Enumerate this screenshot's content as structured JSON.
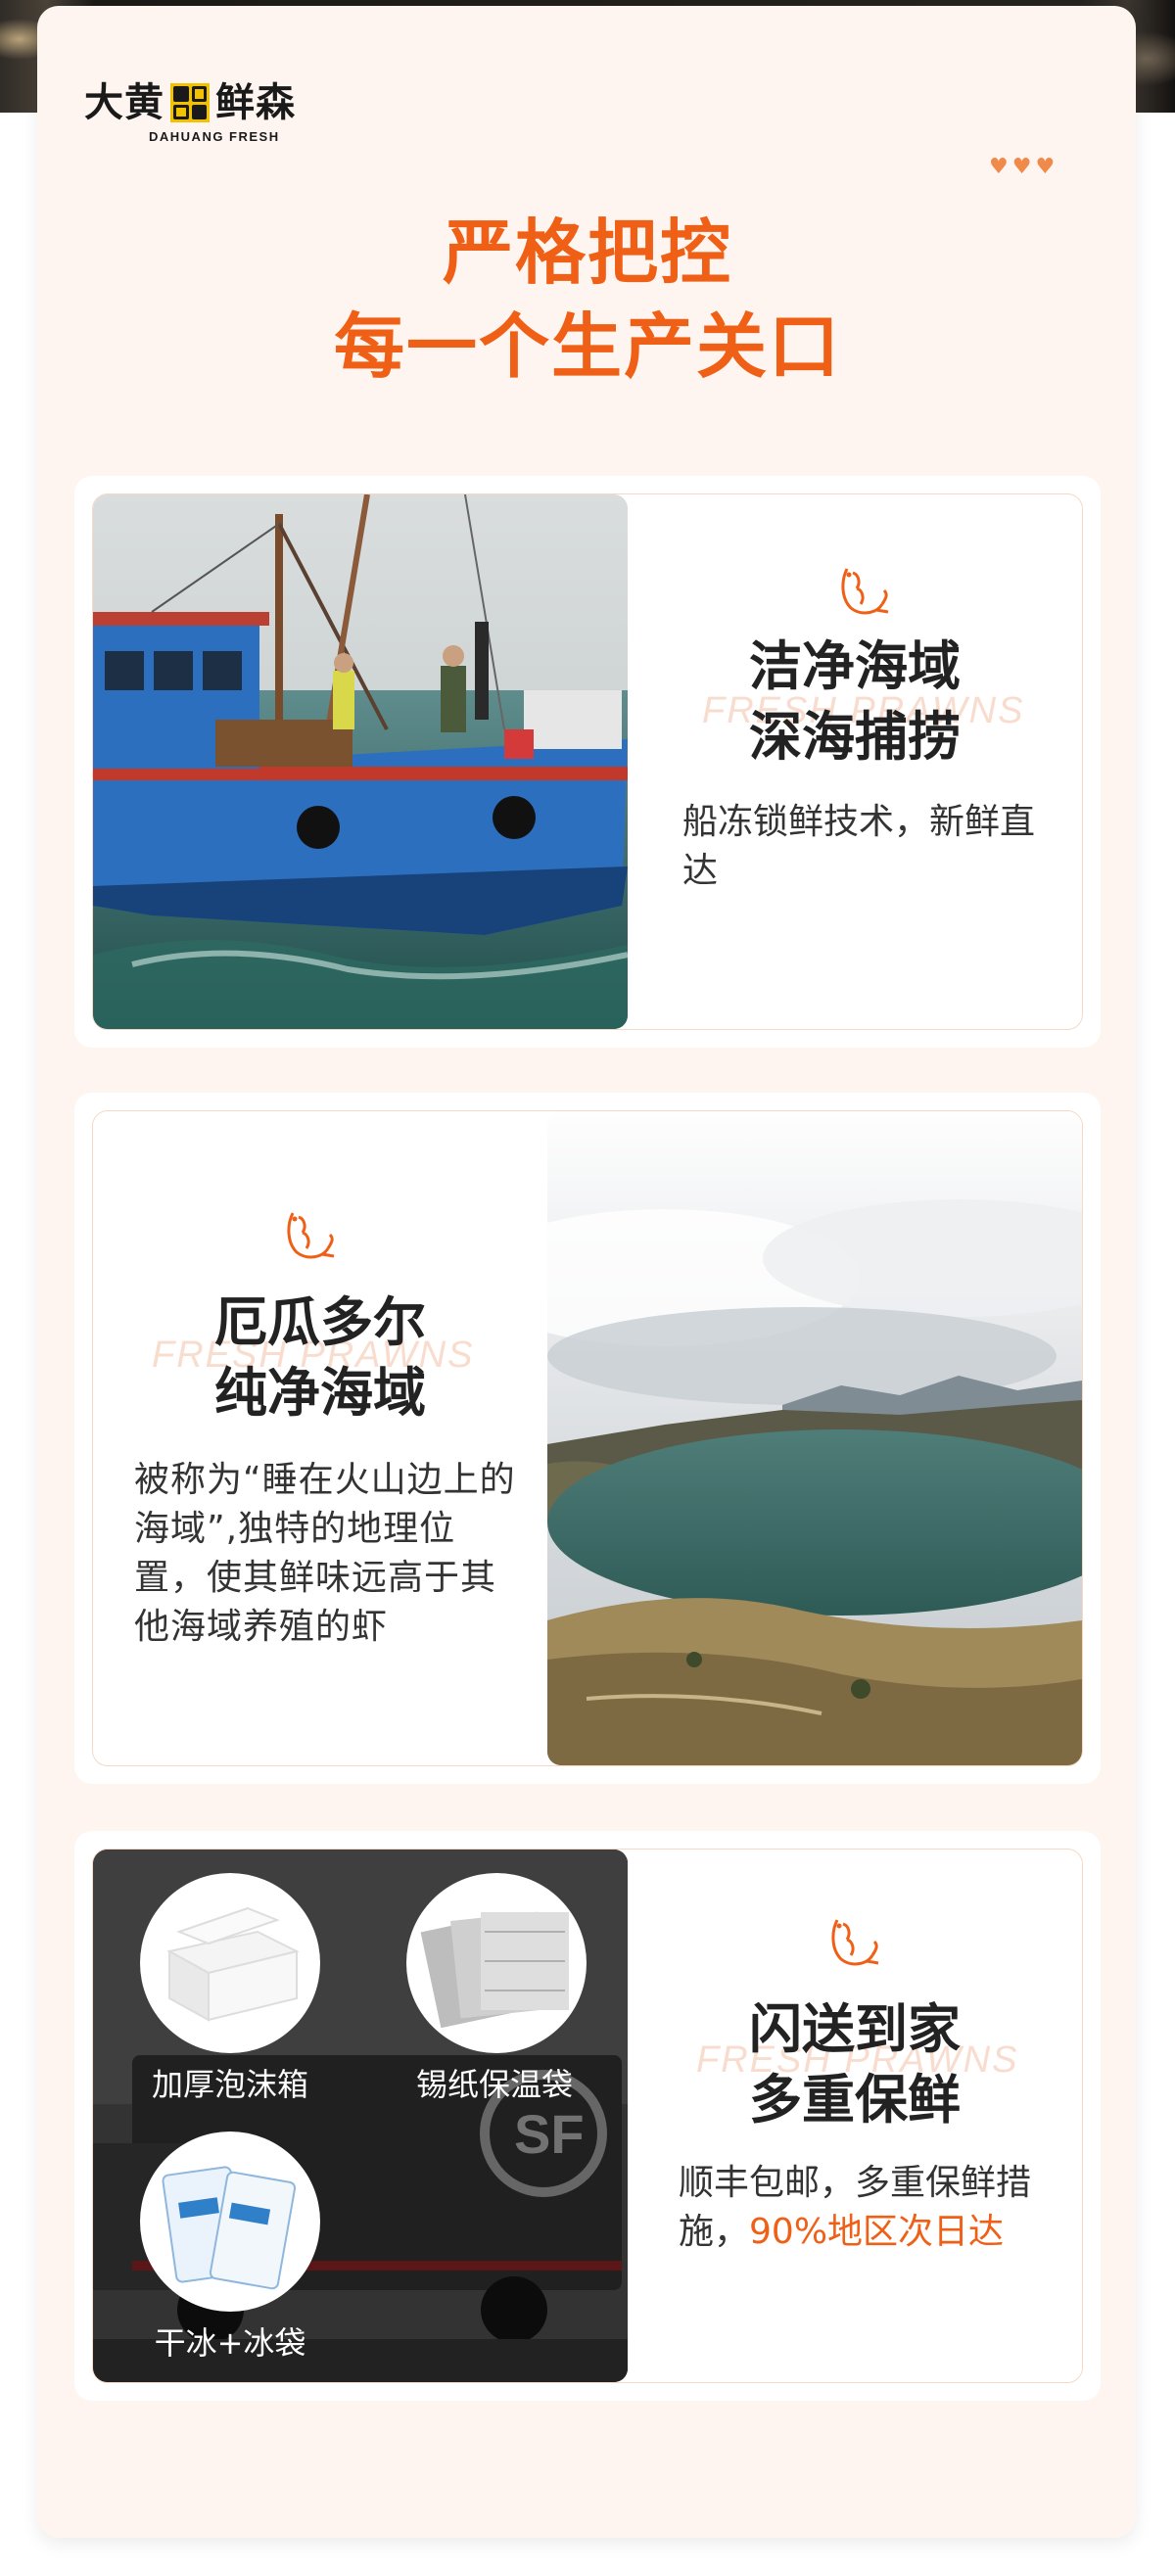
{
  "brand": {
    "name_left": "大黄",
    "name_right": "鲜森",
    "name_en": "DAHUANG FRESH"
  },
  "decor": {
    "hearts": [
      "♥",
      "♥",
      "♥"
    ]
  },
  "headline": {
    "line1": "严格把控",
    "line2": "每一个生产关口"
  },
  "watermark": "FRESH PRAWNS",
  "features": [
    {
      "title_line1": "洁净海域",
      "title_line2": "深海捕捞",
      "desc": "船冻锁鲜技术，新鲜直达",
      "icon": "shrimp-icon",
      "image": "fishing-boat-photo"
    },
    {
      "title_line1": "厄瓜多尔",
      "title_line2": "纯净海域",
      "desc": "被称为“睡在火山边上的海域”,独特的地理位置，使其鲜味远高于其他海域养殖的虾",
      "icon": "shrimp-icon",
      "image": "volcanic-lake-photo"
    },
    {
      "title_line1": "闪送到家",
      "title_line2": "多重保鲜",
      "desc_prefix": "顺丰包邮，多重保鲜措施，",
      "desc_accent": "90%地区次日达",
      "icon": "shrimp-icon",
      "image": "delivery-truck-photo",
      "packaging": [
        {
          "label": "加厚泡沫箱",
          "icon": "foam-box-icon"
        },
        {
          "label": "锡纸保温袋",
          "icon": "foil-bag-icon"
        },
        {
          "label": "干冰+冰袋",
          "icon": "ice-pack-icon"
        }
      ]
    }
  ],
  "colors": {
    "accent": "#ef5f16",
    "card_bg": "#fef5f0",
    "brand_yellow": "#f2c200"
  }
}
